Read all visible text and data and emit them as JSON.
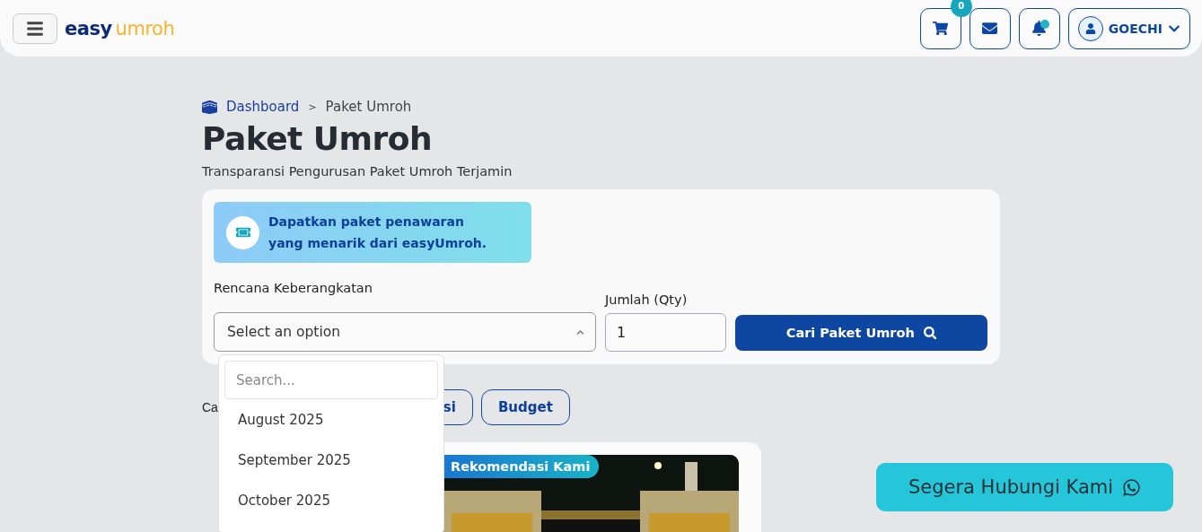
{
  "header": {
    "brand": {
      "part_1": "easy",
      "part_2": "umroh"
    },
    "cart_count": "0",
    "user": "GOECHI"
  },
  "breadcrumb_separator": ">",
  "breadcrumb": [
    {
      "label": "Dashboard",
      "kind": "link"
    },
    {
      "label": "Paket Umroh",
      "kind": "current"
    }
  ],
  "title": "Paket Umroh",
  "subtitle": "Transparansi Pengurusan Paket Umroh Terjamin",
  "search_card": {
    "promo_lines": [
      "Dapatkan paket penawaran",
      "yang menarik dari easyUmroh."
    ],
    "departure": {
      "label": "Rencana Keberangkatan",
      "placeholder": "Select an option",
      "expanded": true
    },
    "qty": {
      "label": "Jumlah (Qty)",
      "value": "1"
    },
    "button": "Cari Paket Umroh"
  },
  "dropdown": {
    "search_placeholder": "Search...",
    "options": [
      "August 2025",
      "September 2025",
      "October 2025"
    ]
  },
  "categories": {
    "label": "Ca",
    "items": [
      {
        "label": "si",
        "selected": false
      },
      {
        "label": "Budget",
        "selected": false
      }
    ]
  },
  "package_card": {
    "badge": "Rekomendasi Kami"
  },
  "contact_button": "Segera Hubungi Kami"
}
